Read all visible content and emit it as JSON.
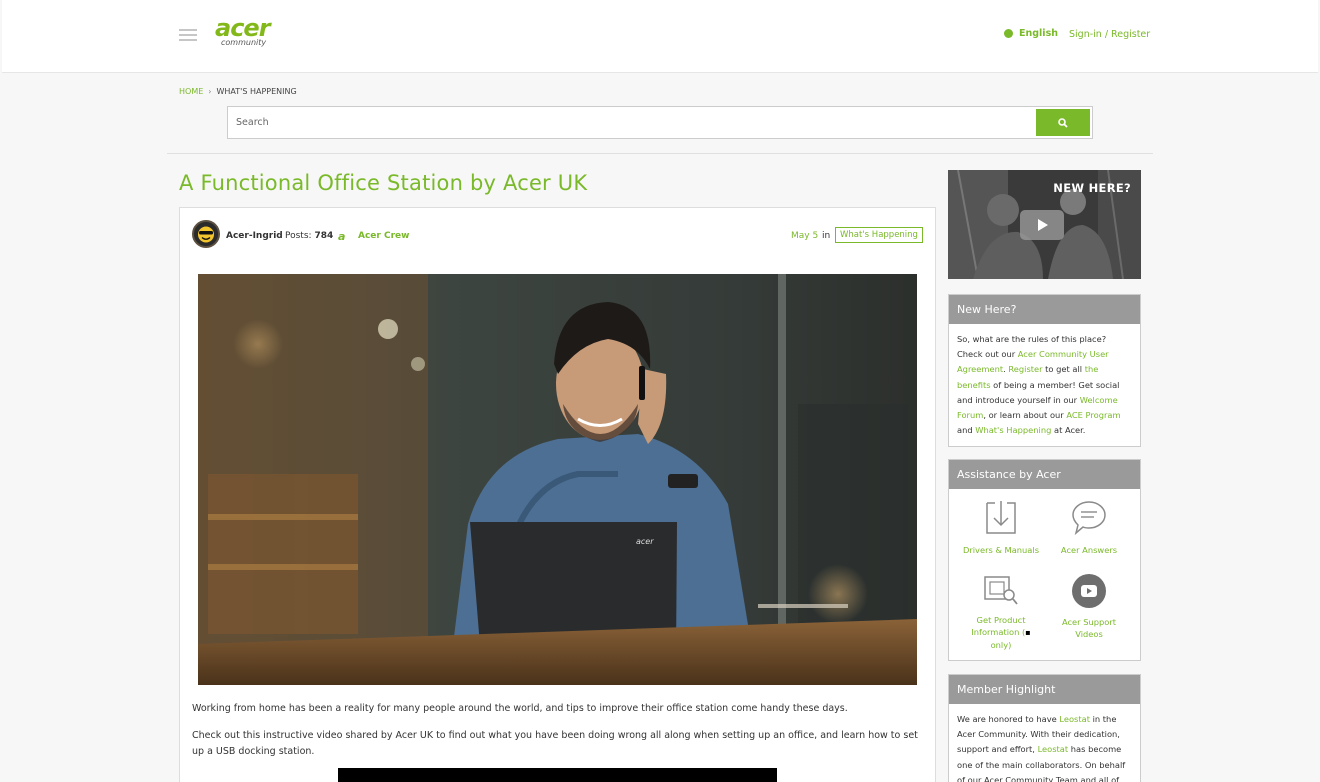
{
  "header": {
    "logo_main": "acer",
    "logo_sub": "community",
    "language": "English",
    "signin": "Sign-in / Register"
  },
  "breadcrumb": {
    "home": "HOME",
    "separator": "›",
    "current": "WHAT'S HAPPENING"
  },
  "search": {
    "placeholder": "Search"
  },
  "post": {
    "title": "A Functional Office Station by Acer UK",
    "author": "Acer-Ingrid",
    "posts_label": "Posts:",
    "posts_count": "784",
    "rank": "Acer Crew",
    "date": "May 5",
    "in_label": "in",
    "category": "What's Happening",
    "laptop_brand": "acer",
    "paragraph1": "Working from home has been a reality for many people around the world, and tips to improve their office station come handy these days.",
    "paragraph2": "Check out this instructive video shared by Acer UK to find out what you have been doing wrong all along when setting up an office, and learn how to set up a USB docking station."
  },
  "sidebar": {
    "promo_text": "NEW HERE?",
    "new_here": {
      "title": "New Here?",
      "t1": "So, what are the rules of this place? Check out our ",
      "l1": "Acer Community User Agreement",
      "t2": ". ",
      "l2": "Register",
      "t3": " to get all ",
      "l3": "the benefits",
      "t4": " of being a member! Get social and introduce yourself in our ",
      "l4": "Welcome Forum",
      "t5": ", or learn about our ",
      "l5": "ACE Program",
      "t6": " and ",
      "l6": "What's Happening",
      "t7": " at Acer."
    },
    "assistance": {
      "title": "Assistance by Acer",
      "drivers": "Drivers & Manuals",
      "answers": "Acer Answers",
      "product_info_a": "Get Product Information (",
      "product_info_b": " only)",
      "videos": "Acer Support Videos"
    },
    "member": {
      "title": "Member Highlight",
      "t1": "We are honored to have ",
      "l1": "Leostat",
      "t2": " in the Acer Community. With their dedication, support and effort, ",
      "l2": "Leostat",
      "t3": " has become one of the main collaborators. On behalf of our Acer Community Team and all of"
    }
  },
  "colors": {
    "accent": "#7ab929",
    "widget_header": "#9a9a9a"
  }
}
